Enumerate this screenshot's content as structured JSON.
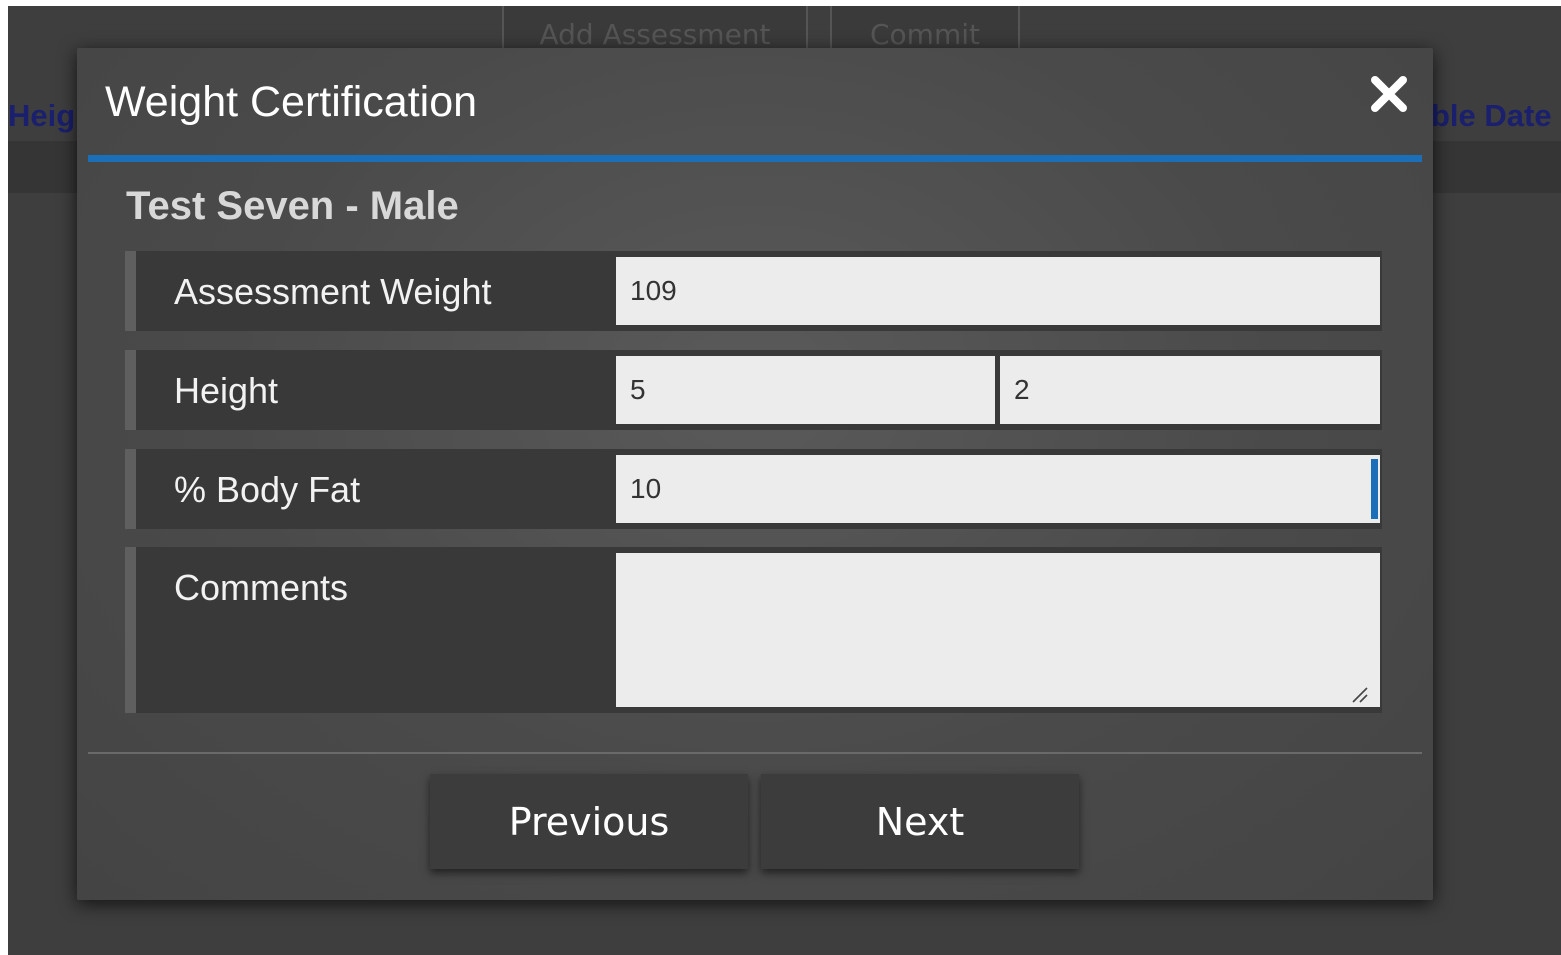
{
  "background": {
    "add_assessment_label": "Add Assessment",
    "commit_label": "Commit",
    "left_column_fragment": "Heig",
    "right_column_fragment": "ble Date"
  },
  "modal": {
    "title": "Weight Certification",
    "close_icon": "close-icon",
    "subject": "Test Seven - Male",
    "accent_color": "#1b6eb8",
    "fields": {
      "assessment_weight": {
        "label": "Assessment Weight",
        "value": "109"
      },
      "height": {
        "label": "Height",
        "feet_value": "5",
        "inches_value": "2"
      },
      "body_fat": {
        "label": "% Body Fat",
        "value": "10"
      },
      "comments": {
        "label": "Comments",
        "value": ""
      }
    },
    "buttons": {
      "previous": "Previous",
      "next": "Next"
    }
  }
}
